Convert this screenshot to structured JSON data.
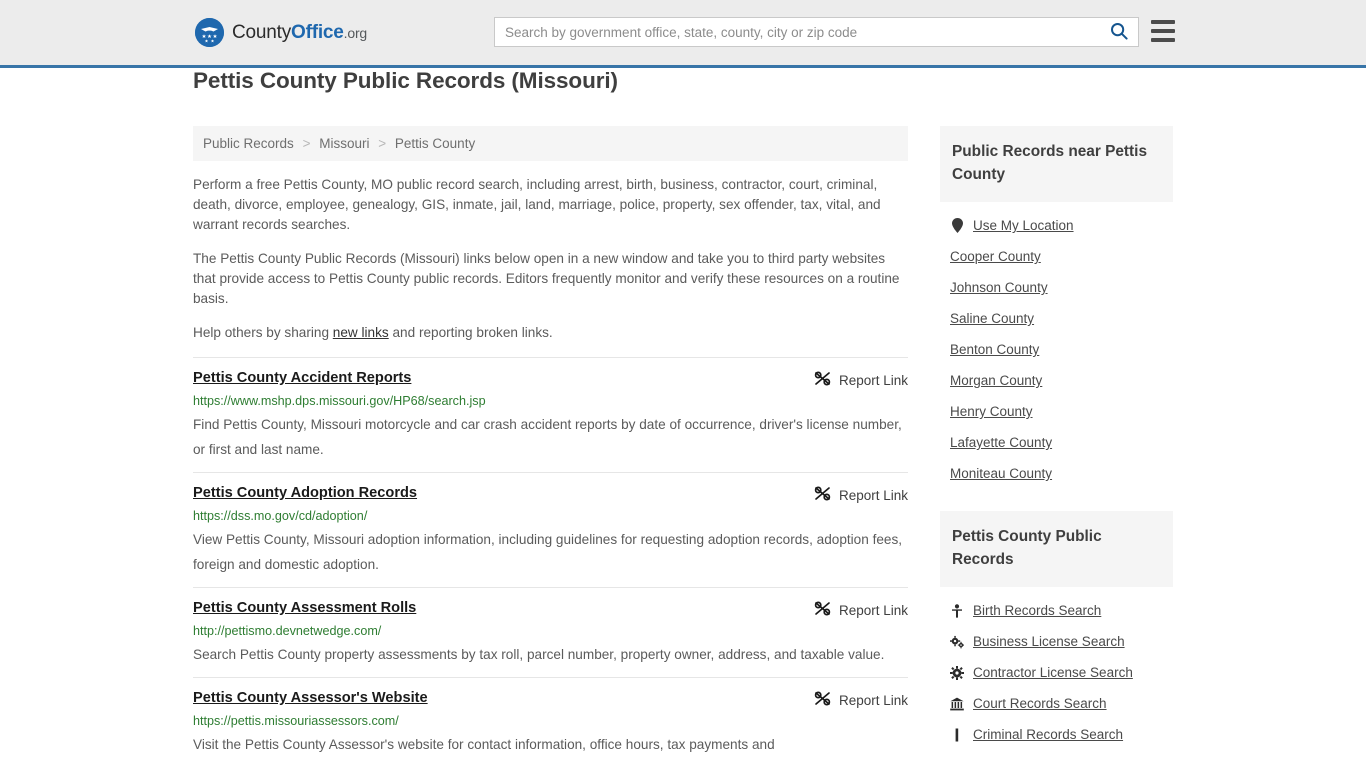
{
  "header": {
    "logo": {
      "part1": "County",
      "part2": "Office",
      "tld": ".org",
      "icon": "eagle-seal-icon"
    },
    "search": {
      "placeholder": "Search by government office, state, county, city or zip code",
      "value": "",
      "button_icon": "search-icon"
    },
    "menu_icon": "hamburger-menu-icon",
    "accent_color": "#3875a8",
    "background_color": "#ececec"
  },
  "main": {
    "title": "Pettis County Public Records (Missouri)",
    "breadcrumb": [
      {
        "label": "Public Records"
      },
      {
        "label": "Missouri"
      },
      {
        "label": "Pettis County"
      }
    ],
    "breadcrumb_separator": ">",
    "intro_paragraphs": [
      "Perform a free Pettis County, MO public record search, including arrest, birth, business, contractor, court, criminal, death, divorce, employee, genealogy, GIS, inmate, jail, land, marriage, police, property, sex offender, tax, vital, and warrant records searches.",
      "The Pettis County Public Records (Missouri) links below open in a new window and take you to third party websites that provide access to Pettis County public records. Editors frequently monitor and verify these resources on a routine basis."
    ],
    "help_text_before": "Help others by sharing ",
    "help_link": "new links",
    "help_text_after": " and reporting broken links.",
    "report_link_label": "Report Link",
    "report_link_icon": "broken-link-icon",
    "records": [
      {
        "title": "Pettis County Accident Reports",
        "url": "https://www.mshp.dps.missouri.gov/HP68/search.jsp",
        "description": "Find Pettis County, Missouri motorcycle and car crash accident reports by date of occurrence, driver's license number, or first and last name."
      },
      {
        "title": "Pettis County Adoption Records",
        "url": "https://dss.mo.gov/cd/adoption/",
        "description": "View Pettis County, Missouri adoption information, including guidelines for requesting adoption records, adoption fees, foreign and domestic adoption."
      },
      {
        "title": "Pettis County Assessment Rolls",
        "url": "http://pettismo.devnetwedge.com/",
        "description": "Search Pettis County property assessments by tax roll, parcel number, property owner, address, and taxable value."
      },
      {
        "title": "Pettis County Assessor's Website",
        "url": "https://pettis.missouriassessors.com/",
        "description": "Visit the Pettis County Assessor's website for contact information, office hours, tax payments and"
      }
    ]
  },
  "sidebar": {
    "nearby": {
      "heading": "Public Records near Pettis County",
      "items": [
        {
          "label": "Use My Location",
          "icon": "map-pin-icon"
        },
        {
          "label": "Cooper County",
          "icon": null
        },
        {
          "label": "Johnson County",
          "icon": null
        },
        {
          "label": "Saline County",
          "icon": null
        },
        {
          "label": "Benton County",
          "icon": null
        },
        {
          "label": "Morgan County",
          "icon": null
        },
        {
          "label": "Henry County",
          "icon": null
        },
        {
          "label": "Lafayette County",
          "icon": null
        },
        {
          "label": "Moniteau County",
          "icon": null
        }
      ]
    },
    "records": {
      "heading": "Pettis County Public Records",
      "items": [
        {
          "label": "Birth Records Search",
          "icon": "baby-icon"
        },
        {
          "label": "Business License Search",
          "icon": "gears-icon"
        },
        {
          "label": "Contractor License Search",
          "icon": "gear-icon"
        },
        {
          "label": "Court Records Search",
          "icon": "courthouse-icon"
        },
        {
          "label": "Criminal Records Search",
          "icon": "gavel-icon"
        }
      ]
    }
  }
}
